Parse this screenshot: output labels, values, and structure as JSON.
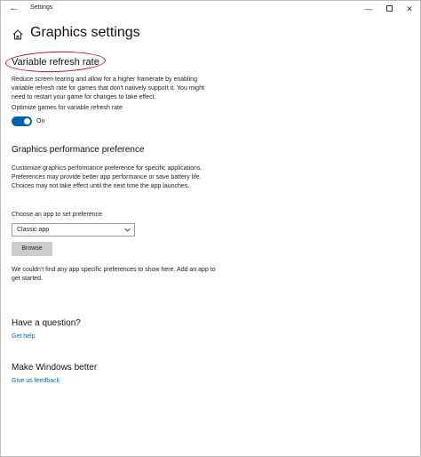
{
  "window": {
    "title": "Settings",
    "back_glyph": "←",
    "minimize_glyph": "—",
    "close_glyph": "✕"
  },
  "page": {
    "title": "Graphics settings"
  },
  "variable_refresh_rate": {
    "heading": "Variable refresh rate",
    "description": "Reduce screen tearing and allow for a higher framerate by enabling variable refresh rate for games that don't natively support it. You might need to restart your game for changes to take effect.",
    "toggle_label": "Optimize games for variable refresh rate",
    "toggle_state": "On",
    "toggle_on": true
  },
  "graphics_performance": {
    "heading": "Graphics performance preference",
    "description": "Customize graphics performance preference for specific applications. Preferences may provide better app performance or save battery life. Choices may not take effect until the next time the app launches.",
    "choose_label": "Choose an app to set preference",
    "dropdown_value": "Classic app",
    "browse_label": "Browse",
    "no_prefs_text": "We couldn't find any app specific preferences to show here. Add an app to get started."
  },
  "question": {
    "heading": "Have a question?",
    "link": "Get help"
  },
  "better": {
    "heading": "Make Windows better",
    "link": "Give us feedback"
  },
  "colors": {
    "accent": "#0063b1",
    "link": "#0067b8",
    "annotation_circle": "#c8102e",
    "button_bg": "#cccccc"
  }
}
